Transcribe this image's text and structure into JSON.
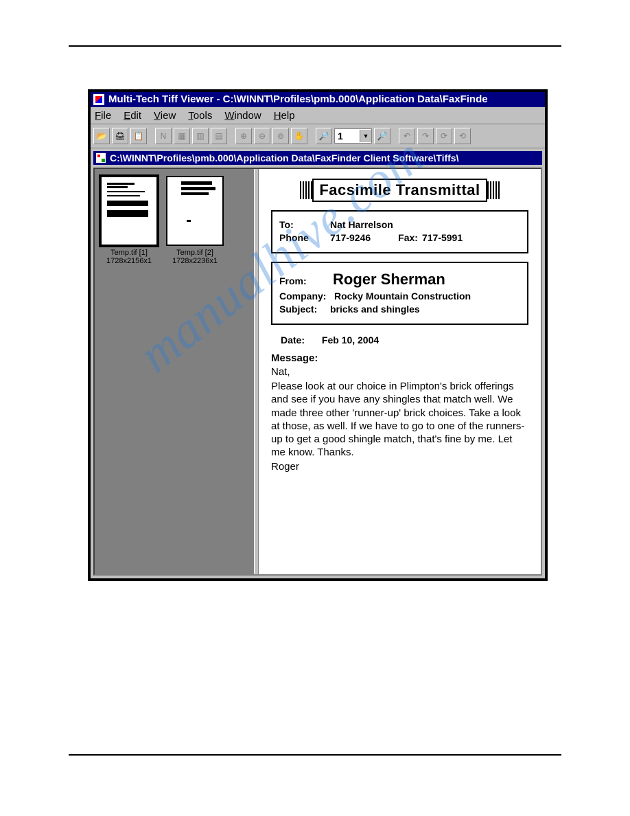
{
  "watermark": "manualhive.com",
  "app": {
    "title": "Multi-Tech Tiff Viewer - C:\\WINNT\\Profiles\\pmb.000\\Application Data\\FaxFinde"
  },
  "menu": {
    "file": "File",
    "edit": "Edit",
    "view": "View",
    "tools": "Tools",
    "window": "Window",
    "help": "Help"
  },
  "toolbar": {
    "page_value": "1"
  },
  "child": {
    "title": "C:\\WINNT\\Profiles\\pmb.000\\Application Data\\FaxFinder Client Software\\Tiffs\\"
  },
  "thumbs": [
    {
      "name": "Temp.tif [1]",
      "dims": "1728x2156x1"
    },
    {
      "name": "Temp.tif [2]",
      "dims": "1728x2236x1"
    }
  ],
  "fax": {
    "heading": "Facsimile Transmittal",
    "to_label": "To:",
    "to": "Nat Harrelson",
    "phone_label": "Phone",
    "phone": "717-9246",
    "fax_label": "Fax:",
    "fax": "717-5991",
    "from_label": "From:",
    "from": "Roger Sherman",
    "company_label": "Company:",
    "company": "Rocky Mountain Construction",
    "subject_label": "Subject:",
    "subject": "bricks and shingles",
    "date_label": "Date:",
    "date": "Feb 10, 2004",
    "message_label": "Message:",
    "greeting": "Nat,",
    "body": "Please look at our choice in Plimpton's brick offerings and see if you have any shingles that match well.  We made three other 'runner-up' brick choices.  Take a look at those, as  well.  If we have to go to one of the runners-up to get a good shingle match, that's fine by  me.  Let me know. Thanks.",
    "signoff": "Roger"
  }
}
